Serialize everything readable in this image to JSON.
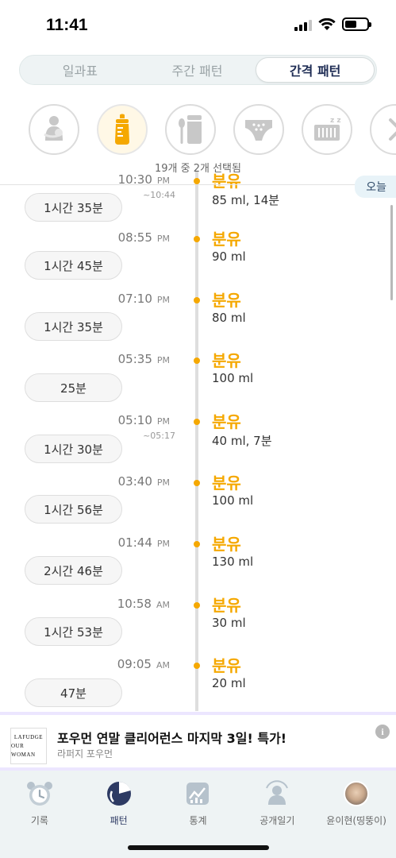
{
  "status": {
    "time": "11:41"
  },
  "tabs": [
    {
      "label": "일과표",
      "active": false
    },
    {
      "label": "주간 패턴",
      "active": false
    },
    {
      "label": "간격 패턴",
      "active": true
    }
  ],
  "categories": [
    {
      "icon": "breastfeeding-icon",
      "active": false
    },
    {
      "icon": "baby-bottle-icon",
      "active": true,
      "color": "#f5a800"
    },
    {
      "icon": "baby-food-icon",
      "active": false
    },
    {
      "icon": "diaper-icon",
      "active": false
    },
    {
      "icon": "sleep-crib-icon",
      "active": false
    },
    {
      "icon": "more-chevron-icon",
      "active": false
    }
  ],
  "selection": {
    "text": "19개 중 2개 선택됨"
  },
  "timeline": {
    "today_label": "오늘",
    "first": {
      "time": "10:30",
      "ampm": "PM",
      "sub": "~10:44",
      "title": "분유",
      "amount": "85 ml, 14분"
    },
    "entries": [
      {
        "time": "08:55",
        "ampm": "PM",
        "sub": "",
        "title": "분유",
        "amount": "90 ml"
      },
      {
        "time": "07:10",
        "ampm": "PM",
        "sub": "",
        "title": "분유",
        "amount": "80 ml"
      },
      {
        "time": "05:35",
        "ampm": "PM",
        "sub": "",
        "title": "분유",
        "amount": "100 ml"
      },
      {
        "time": "05:10",
        "ampm": "PM",
        "sub": "~05:17",
        "title": "분유",
        "amount": "40 ml, 7분"
      },
      {
        "time": "03:40",
        "ampm": "PM",
        "sub": "",
        "title": "분유",
        "amount": "100 ml"
      },
      {
        "time": "01:44",
        "ampm": "PM",
        "sub": "",
        "title": "분유",
        "amount": "130 ml"
      },
      {
        "time": "10:58",
        "ampm": "AM",
        "sub": "",
        "title": "분유",
        "amount": "30 ml"
      },
      {
        "time": "09:05",
        "ampm": "AM",
        "sub": "",
        "title": "분유",
        "amount": "20 ml"
      }
    ],
    "intervals": [
      "1시간 35분",
      "1시간 45분",
      "1시간 35분",
      "25분",
      "1시간 30분",
      "1시간 56분",
      "2시간 46분",
      "1시간 53분",
      "47분"
    ]
  },
  "ad": {
    "logo_line1": "LAFUDGE",
    "logo_line2": "OUR WOMAN",
    "title": "포우먼 연말 클리어런스 마지막 3일! 특가!",
    "subtitle": "라퍼지 포우먼",
    "info": "i"
  },
  "bottom_nav": [
    {
      "label": "기록",
      "icon": "alarm-clock-icon",
      "active": false
    },
    {
      "label": "패턴",
      "icon": "pattern-chart-icon",
      "active": true
    },
    {
      "label": "통계",
      "icon": "statistics-icon",
      "active": false
    },
    {
      "label": "공개일기",
      "icon": "public-diary-icon",
      "active": false
    },
    {
      "label": "윤이현(띵뚱이)",
      "icon": "profile-avatar",
      "active": false
    }
  ]
}
